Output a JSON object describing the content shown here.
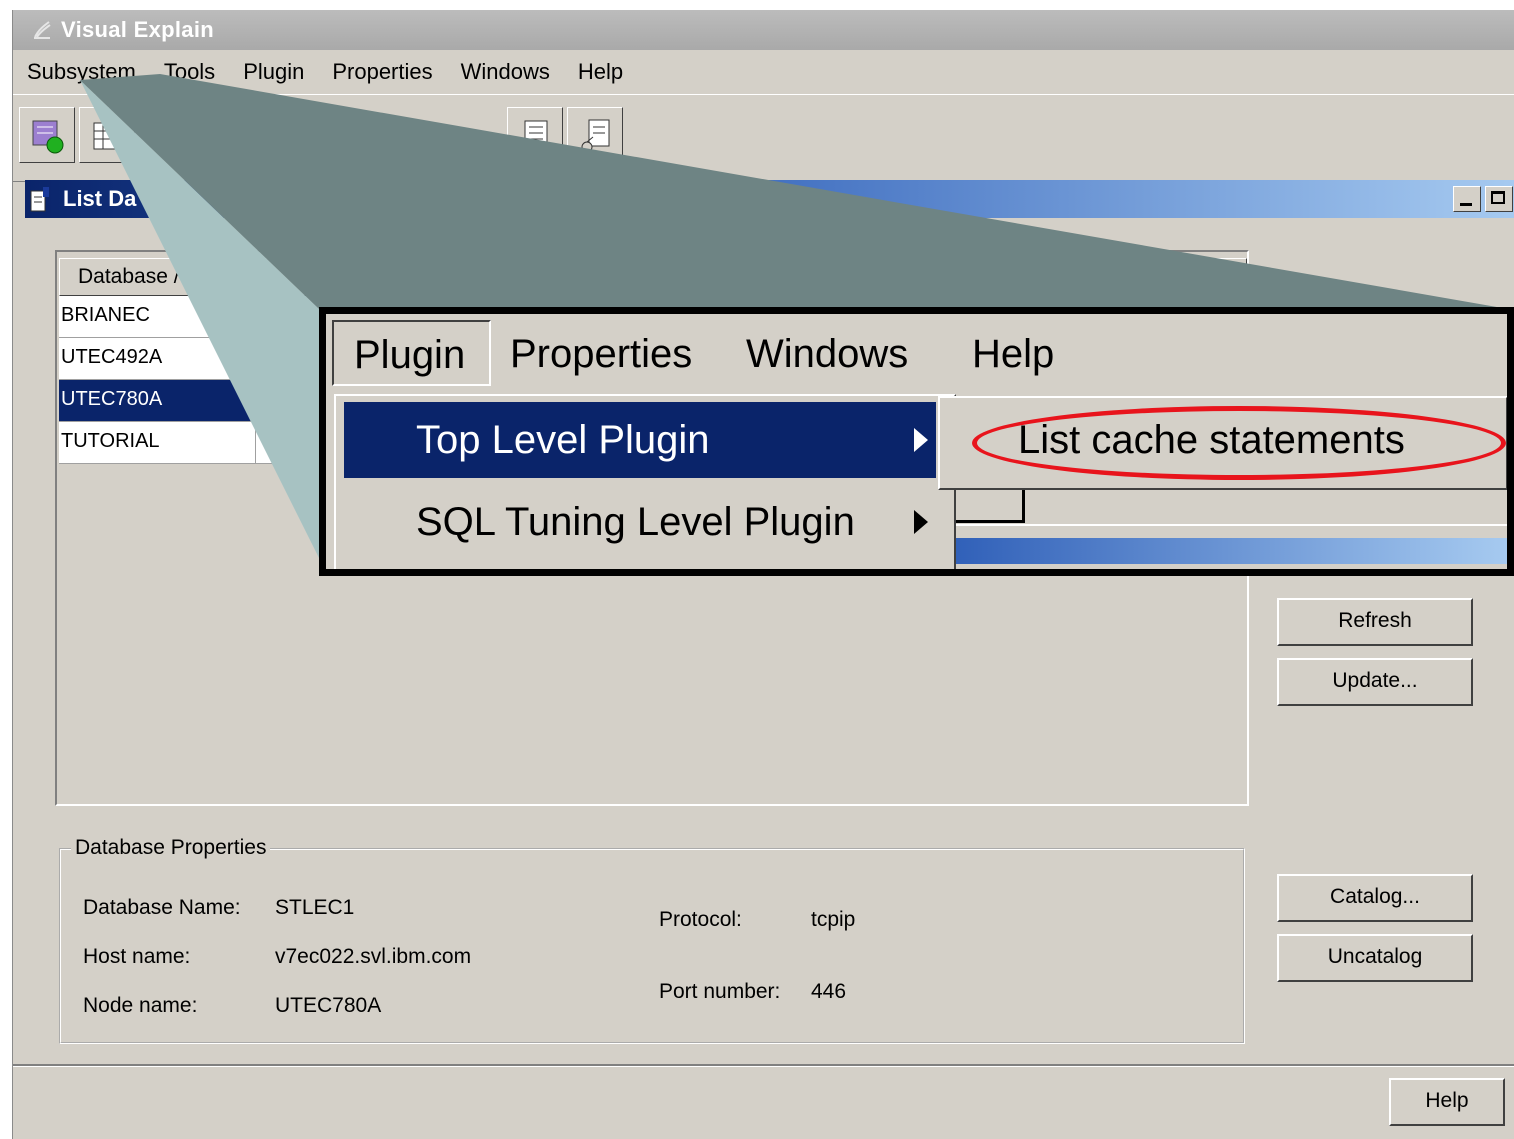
{
  "window": {
    "title": "Visual Explain"
  },
  "menubar": [
    "Subsystem",
    "Tools",
    "Plugin",
    "Properties",
    "Windows",
    "Help"
  ],
  "toolbar": {
    "icons": [
      "subsystem-icon",
      "table-icon",
      "document-icon",
      "diagram-icon"
    ]
  },
  "internal_window": {
    "title": "List Da"
  },
  "database_list": {
    "header": "Database /",
    "rows": [
      "BRIANEC",
      "UTEC492A",
      "UTEC780A",
      "TUTORIAL"
    ],
    "selected_index": 2
  },
  "buttons": {
    "refresh": "Refresh",
    "update": "Update...",
    "catalog": "Catalog...",
    "uncatalog": "Uncatalog",
    "help": "Help"
  },
  "properties": {
    "legend": "Database Properties",
    "database_name_label": "Database Name:",
    "database_name": "STLEC1",
    "host_name_label": "Host name:",
    "host_name": "v7ec022.svl.ibm.com",
    "node_name_label": "Node name:",
    "node_name": "UTEC780A",
    "protocol_label": "Protocol:",
    "protocol": "tcpip",
    "port_label": "Port number:",
    "port": "446"
  },
  "callout": {
    "menubar": [
      "Plugin",
      "Properties",
      "Windows",
      "Help"
    ],
    "menu_items": [
      "Top Level Plugin",
      "SQL Tuning Level Plugin"
    ],
    "submenu_items": [
      "List cache statements"
    ],
    "highlight_color": "#e8141c"
  },
  "colors": {
    "selection": "#0a246a",
    "face": "#d4d0c8",
    "callout_fill": "#6e8484"
  }
}
